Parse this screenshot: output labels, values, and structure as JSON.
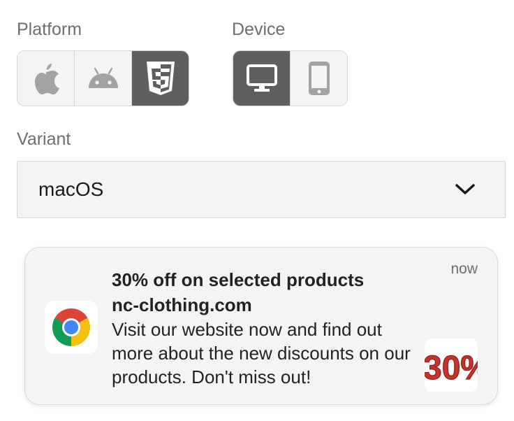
{
  "platform": {
    "label": "Platform",
    "options": [
      {
        "icon": "apple-icon",
        "selected": false
      },
      {
        "icon": "android-icon",
        "selected": false
      },
      {
        "icon": "html5-icon",
        "selected": true
      }
    ]
  },
  "device": {
    "label": "Device",
    "options": [
      {
        "icon": "desktop-icon",
        "selected": true
      },
      {
        "icon": "mobile-icon",
        "selected": false
      }
    ]
  },
  "variant": {
    "label": "Variant",
    "value": "macOS"
  },
  "notification": {
    "title": "30% off on selected products",
    "site": "nc-clothing.com",
    "body": "Visit our website now and find out more about the new discounts on our products. Don't miss out!",
    "time": "now",
    "app_icon": "chrome-icon",
    "image_text": "30%"
  },
  "colors": {
    "active_segment": "#5f5f5f",
    "inactive_icon": "#a3a3a3",
    "chrome_red": "#db4437",
    "chrome_yellow": "#f4c20d",
    "chrome_green": "#0f9d58",
    "chrome_blue": "#4285f4"
  }
}
